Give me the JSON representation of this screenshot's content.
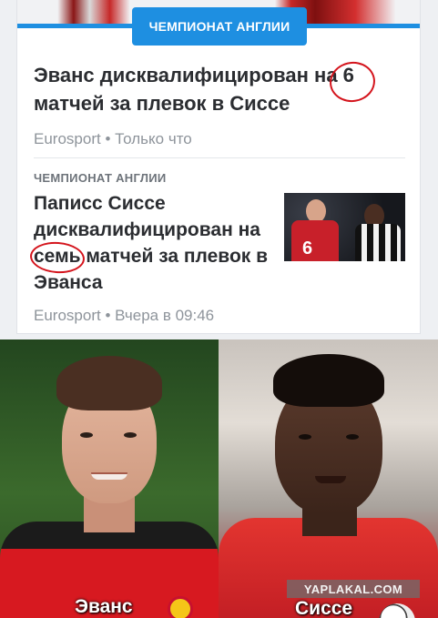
{
  "news_card": {
    "category_badge": "ЧЕМПИОНАТ АНГЛИИ",
    "articles": [
      {
        "headline_before": "Эванс дисквалифицирован на ",
        "headline_circled": "6",
        "headline_after": "матчей за плевок в Сиссе",
        "source": "Eurosport",
        "time": "Только что"
      },
      {
        "category": "ЧЕМПИОНАТ АНГЛИИ",
        "headline_line1": "Паписс Сиссе дисквалифицирован на ",
        "headline_circled": "семь",
        "headline_after": " матчей за плевок в Эванса",
        "source": "Eurosport",
        "time": "Вчера в 09:46",
        "thumbnail_shirt_number": "6"
      }
    ],
    "meta_separator": "•"
  },
  "photos": {
    "left_caption": "Эванс",
    "right_caption": "Сиссе",
    "watermark": "YAPLAKAL.COM"
  },
  "colors": {
    "accent": "#1e8fe1",
    "pen_circle": "#d4141c",
    "headline": "#2b2d31",
    "meta": "#8e949b"
  }
}
